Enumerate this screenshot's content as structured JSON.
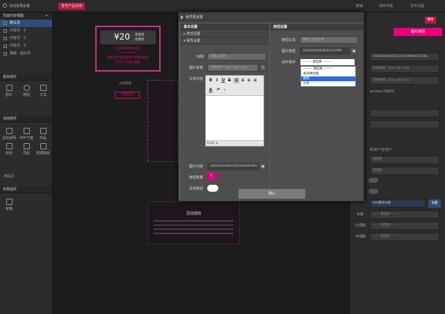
{
  "topbar": {
    "global_settings": "活动全局设置",
    "publish_button": "发布产品详情",
    "undo": "撤销",
    "save_draft": "保存草稿",
    "publish_page": "发布页面"
  },
  "leftpanel": {
    "pages_title": "页面内容视图",
    "add_icon": "+",
    "pages": [
      {
        "label": "默认页",
        "active": true
      },
      {
        "label": "内容页 - 1",
        "active": false
      },
      {
        "label": "内容页 - 2",
        "active": false
      },
      {
        "label": "内容页 - 3",
        "active": false
      },
      {
        "label": "弹窗 - 提示页",
        "active": false
      }
    ],
    "basic_title": "基本组件",
    "basic_tools": [
      {
        "label": "图片",
        "icon": "image-icon"
      },
      {
        "label": "按钮",
        "icon": "circle-button-icon"
      },
      {
        "label": "文本",
        "icon": "text-icon"
      }
    ],
    "activity_title": "活动组件",
    "activity_tools": [
      {
        "label": "活动说明",
        "icon": "document-icon"
      },
      {
        "label": "APP下载",
        "icon": "download-icon"
      },
      {
        "label": "商品",
        "icon": "product-icon"
      },
      {
        "label": "抢购",
        "icon": "rush-icon"
      },
      {
        "label": "导航",
        "icon": "nav-icon"
      },
      {
        "label": "数据跳转",
        "icon": "swap-icon"
      }
    ],
    "misc_label": "精品区",
    "layout_title": "布局组件",
    "layout_tools": [
      {
        "label": "宫格",
        "icon": "grid-icon"
      }
    ]
  },
  "canvas": {
    "coupon_amount": "¥20",
    "coupon_label1": "现金抵",
    "coupon_label2": "优惠券",
    "line1": "已发放到手机号码",
    "line2": "**********",
    "line3": "使用该手机号登录/注册商品会",
    "line4": "在个人卡券包查看",
    "link_text": "立即查看",
    "coupon_button": "去用红包",
    "rules_title": "活动规则"
  },
  "dialog": {
    "title": "组件框设置",
    "basic_settings": "基本设置",
    "style_settings": "样式设置",
    "attr_settings": "属性设置",
    "title_label": "标题",
    "title_placeholder": "请输入标题",
    "image_label": "图片背景",
    "image_placeholder": "支持格式：jpg | gif | png",
    "text_label": "文本内容",
    "editor_footer": "body  p",
    "image_content_label": "图片内容",
    "image_content_value": "/2016/04/06/6295/145990493",
    "button_count_label": "按钮数量",
    "button_count_value": "1",
    "close_button_label": "关闭按钮",
    "confirm": "确认",
    "button_settings": "按钮设置",
    "button_text_label": "按钮文本",
    "button_text_placeholder": "请输入按钮文本",
    "button_image_label": "图片按钮",
    "button_image_value": "/2016/04/06/8050/14599",
    "action_label": "动作事件",
    "action_selected": "-------- 请选择 --------",
    "action_options": [
      {
        "label": "-------- 请选择 --------",
        "selected": false
      },
      {
        "label": "关闭弹出框",
        "selected": false
      },
      {
        "label": "跳转",
        "selected": true
      },
      {
        "label": "分享",
        "selected": false
      }
    ]
  },
  "rightpanel": {
    "top_button": "删除",
    "tab_active": "图片按钮",
    "value1": "/2016/04/06/6123/1459904731481",
    "placeholder1": "支持格式：jpg | gif | png",
    "placeholder2": "支持格式：jpg | gif | png",
    "anchor": "anchor-78603",
    "new_user_label": "新用户/老用户",
    "select_placeholder": "请选择",
    "conf_label": "VUI事件分组",
    "conf_button": "设置",
    "row_day": "天数",
    "row_used": "已领取",
    "row_fixed": "可领取",
    "select_default": "------ 请选择 ------"
  },
  "colors": {
    "accent": "#e6007e",
    "active_item": "#2f4d78",
    "dropdown_selected": "#2d6ed6",
    "topbar_red": "#b71c3d"
  }
}
